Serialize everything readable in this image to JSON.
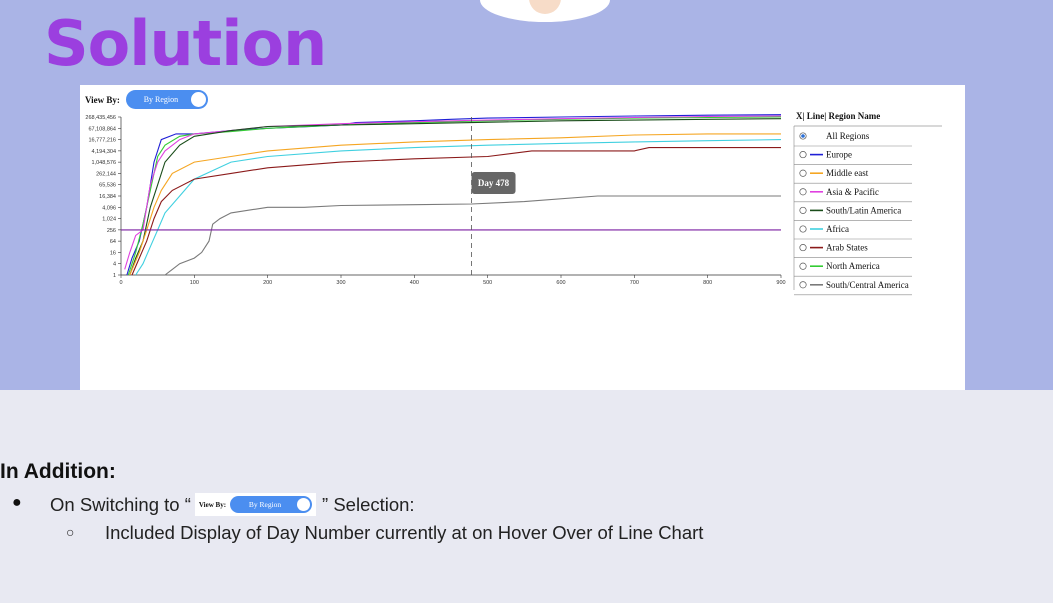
{
  "slide": {
    "title": "Solution",
    "colors": {
      "top_band": "#aab4e6",
      "title": "#9b3fdf",
      "bottom_band": "#e8e9f2"
    }
  },
  "view_by": {
    "label": "View By:",
    "toggle_label": "By Region",
    "toggle_on": true,
    "toggle_color": "#4b8ef0"
  },
  "legend": {
    "header": "X| Line| Region Name",
    "selected": "All Regions",
    "items": [
      {
        "label": "All Regions",
        "color": null
      },
      {
        "label": "Europe",
        "color": "#1f1fd6"
      },
      {
        "label": "Middle east",
        "color": "#f5a623"
      },
      {
        "label": "Asia & Pacific",
        "color": "#e040e0"
      },
      {
        "label": "South/Latin America",
        "color": "#1a4d1a"
      },
      {
        "label": "Africa",
        "color": "#40d0e0"
      },
      {
        "label": "Arab States",
        "color": "#8b1a1a"
      },
      {
        "label": "North America",
        "color": "#33cc33"
      },
      {
        "label": "South/Central America",
        "color": "#7a7a7a"
      }
    ]
  },
  "chart_data": {
    "type": "line",
    "x_ticks": [
      "0",
      "100",
      "200",
      "300",
      "400",
      "500",
      "600",
      "700",
      "800",
      "900"
    ],
    "y_ticks": [
      "1",
      "4",
      "16",
      "64",
      "256",
      "1,024",
      "4,096",
      "16,384",
      "65,536",
      "262,144",
      "1,048,576",
      "4,194,304",
      "16,777,216",
      "67,108,864",
      "268,435,456"
    ],
    "y_scale": "log2",
    "xlim": [
      0,
      900
    ],
    "tooltip": {
      "day": 478,
      "label": "Day 478"
    },
    "series": [
      {
        "color": "#1f1fd6",
        "points": [
          [
            8,
            1
          ],
          [
            15,
            8
          ],
          [
            25,
            64
          ],
          [
            35,
            4096
          ],
          [
            45,
            1048576
          ],
          [
            55,
            16777216
          ],
          [
            75,
            33554432
          ],
          [
            100,
            33554432
          ],
          [
            150,
            50331648
          ],
          [
            200,
            67108864
          ],
          [
            260,
            83886080
          ],
          [
            300,
            100663296
          ],
          [
            320,
            134217728
          ],
          [
            360,
            150994944
          ],
          [
            400,
            167772160
          ],
          [
            450,
            201326592
          ],
          [
            500,
            234881024
          ],
          [
            600,
            268435456
          ],
          [
            700,
            301989888
          ],
          [
            800,
            335544320
          ],
          [
            900,
            355000000
          ]
        ]
      },
      {
        "color": "#33cc33",
        "points": [
          [
            10,
            1
          ],
          [
            20,
            16
          ],
          [
            30,
            512
          ],
          [
            40,
            32768
          ],
          [
            50,
            2097152
          ],
          [
            60,
            8388608
          ],
          [
            80,
            25165824
          ],
          [
            100,
            33554432
          ],
          [
            150,
            44739242
          ],
          [
            200,
            67108864
          ],
          [
            300,
            100663296
          ],
          [
            400,
            134217728
          ],
          [
            500,
            167772160
          ],
          [
            600,
            201326592
          ],
          [
            700,
            234881024
          ],
          [
            800,
            251658240
          ],
          [
            900,
            268435456
          ]
        ]
      },
      {
        "color": "#e040e0",
        "points": [
          [
            5,
            2
          ],
          [
            12,
            16
          ],
          [
            20,
            128
          ],
          [
            30,
            256
          ],
          [
            40,
            65536
          ],
          [
            50,
            1048576
          ],
          [
            60,
            4194304
          ],
          [
            80,
            16777216
          ],
          [
            100,
            33554432
          ],
          [
            150,
            50331648
          ],
          [
            200,
            83886080
          ],
          [
            300,
            117440512
          ],
          [
            400,
            150994944
          ],
          [
            500,
            184549376
          ],
          [
            600,
            218103808
          ],
          [
            700,
            251658240
          ],
          [
            800,
            285212672
          ],
          [
            900,
            301989888
          ]
        ]
      },
      {
        "color": "#1a4d1a",
        "points": [
          [
            12,
            1
          ],
          [
            20,
            8
          ],
          [
            30,
            64
          ],
          [
            40,
            4096
          ],
          [
            50,
            65536
          ],
          [
            60,
            1048576
          ],
          [
            80,
            8388608
          ],
          [
            100,
            25165824
          ],
          [
            150,
            50331648
          ],
          [
            200,
            83886080
          ],
          [
            300,
            100663296
          ],
          [
            400,
            117440512
          ],
          [
            478,
            134217728
          ],
          [
            600,
            167772160
          ],
          [
            700,
            184549376
          ],
          [
            800,
            201326592
          ],
          [
            900,
            218103808
          ]
        ]
      },
      {
        "color": "#f5a623",
        "points": [
          [
            12,
            1
          ],
          [
            25,
            16
          ],
          [
            35,
            256
          ],
          [
            45,
            4096
          ],
          [
            55,
            32768
          ],
          [
            70,
            262144
          ],
          [
            100,
            1048576
          ],
          [
            150,
            2097152
          ],
          [
            200,
            4194304
          ],
          [
            300,
            8388608
          ],
          [
            400,
            12582912
          ],
          [
            500,
            16777216
          ],
          [
            600,
            20971520
          ],
          [
            700,
            29360128
          ],
          [
            800,
            33554432
          ],
          [
            900,
            33554432
          ]
        ]
      },
      {
        "color": "#40d0e0",
        "points": [
          [
            20,
            1
          ],
          [
            30,
            4
          ],
          [
            40,
            32
          ],
          [
            50,
            256
          ],
          [
            60,
            2048
          ],
          [
            80,
            16384
          ],
          [
            100,
            131072
          ],
          [
            150,
            1048576
          ],
          [
            200,
            2097152
          ],
          [
            300,
            4194304
          ],
          [
            400,
            6291456
          ],
          [
            500,
            8388608
          ],
          [
            600,
            10485760
          ],
          [
            700,
            12582912
          ],
          [
            800,
            14680064
          ],
          [
            900,
            16777216
          ]
        ]
      },
      {
        "color": "#8b1a1a",
        "points": [
          [
            15,
            1
          ],
          [
            25,
            8
          ],
          [
            35,
            64
          ],
          [
            45,
            1024
          ],
          [
            55,
            8192
          ],
          [
            70,
            32768
          ],
          [
            100,
            131072
          ],
          [
            150,
            262144
          ],
          [
            200,
            524288
          ],
          [
            300,
            1048576
          ],
          [
            400,
            1572864
          ],
          [
            500,
            2097152
          ],
          [
            560,
            4194304
          ],
          [
            700,
            4194304
          ],
          [
            720,
            6291456
          ],
          [
            800,
            6291456
          ],
          [
            900,
            6291456
          ]
        ]
      },
      {
        "color": "#7a7a7a",
        "points": [
          [
            60,
            1
          ],
          [
            70,
            2
          ],
          [
            80,
            4
          ],
          [
            100,
            8
          ],
          [
            110,
            16
          ],
          [
            120,
            64
          ],
          [
            125,
            512
          ],
          [
            135,
            1024
          ],
          [
            150,
            2048
          ],
          [
            200,
            4096
          ],
          [
            250,
            4096
          ],
          [
            300,
            5120
          ],
          [
            400,
            5632
          ],
          [
            478,
            6144
          ],
          [
            550,
            8192
          ],
          [
            650,
            16384
          ],
          [
            750,
            16384
          ],
          [
            900,
            16384
          ]
        ]
      },
      {
        "color": "#7b1fa2",
        "points": [
          [
            0,
            256
          ],
          [
            900,
            256
          ]
        ]
      }
    ]
  },
  "addition": {
    "heading": "In Addition:",
    "bullet1_before": "On Switching to “",
    "bullet1_after": " ” Selection:",
    "sub_bullet": "Included Display of Day Number currently at on Hover Over of Line Chart",
    "bullet_char": "●",
    "sub_bullet_char": "○"
  }
}
